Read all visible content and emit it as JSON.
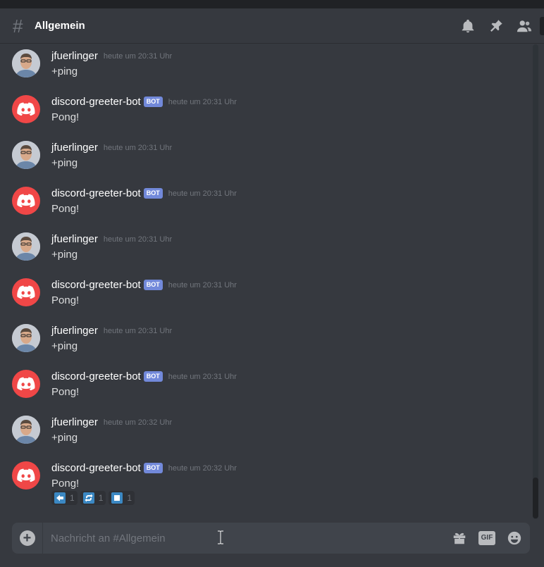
{
  "header": {
    "hash_glyph": "#",
    "channel_name": "Allgemein"
  },
  "messages": [
    {
      "author": "jfuerlinger",
      "bot": false,
      "timestamp": "heute um 20:31 Uhr",
      "text": "+ping"
    },
    {
      "author": "discord-greeter-bot",
      "bot": true,
      "bot_tag": "BOT",
      "timestamp": "heute um 20:31 Uhr",
      "text": "Pong!"
    },
    {
      "author": "jfuerlinger",
      "bot": false,
      "timestamp": "heute um 20:31 Uhr",
      "text": "+ping"
    },
    {
      "author": "discord-greeter-bot",
      "bot": true,
      "bot_tag": "BOT",
      "timestamp": "heute um 20:31 Uhr",
      "text": "Pong!"
    },
    {
      "author": "jfuerlinger",
      "bot": false,
      "timestamp": "heute um 20:31 Uhr",
      "text": "+ping"
    },
    {
      "author": "discord-greeter-bot",
      "bot": true,
      "bot_tag": "BOT",
      "timestamp": "heute um 20:31 Uhr",
      "text": "Pong!"
    },
    {
      "author": "jfuerlinger",
      "bot": false,
      "timestamp": "heute um 20:31 Uhr",
      "text": "+ping"
    },
    {
      "author": "discord-greeter-bot",
      "bot": true,
      "bot_tag": "BOT",
      "timestamp": "heute um 20:31 Uhr",
      "text": "Pong!"
    },
    {
      "author": "jfuerlinger",
      "bot": false,
      "timestamp": "heute um 20:32 Uhr",
      "text": "+ping"
    },
    {
      "author": "discord-greeter-bot",
      "bot": true,
      "bot_tag": "BOT",
      "timestamp": "heute um 20:32 Uhr",
      "text": "Pong!"
    }
  ],
  "reactions": [
    {
      "icon": "arrow-left-icon",
      "count": "1"
    },
    {
      "icon": "repeat-icon",
      "count": "1"
    },
    {
      "icon": "stop-square-icon",
      "count": "1"
    }
  ],
  "composer": {
    "plus_glyph": "+",
    "placeholder": "Nachricht an #Allgemein",
    "gif_label": "GIF"
  },
  "colors": {
    "background": "#36393f",
    "accent_bot_tag": "#7289da",
    "bot_avatar": "#f04747",
    "reaction_emoji": "#3b88c3"
  }
}
